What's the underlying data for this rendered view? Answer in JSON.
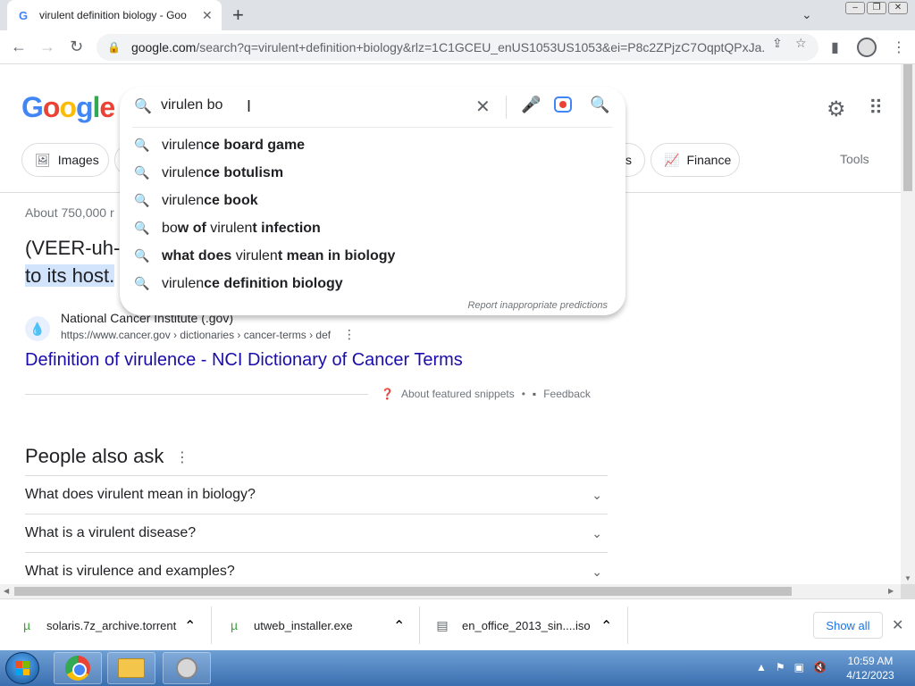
{
  "browser": {
    "tab_title": "virulent definition biology - Goo",
    "tab_favicon": "G",
    "url_main": "google.com",
    "url_rest": "/search?q=virulent+definition+biology&rlz=1C1GCEU_enUS1053US1053&ei=P8c2ZPjzC7OqptQPxJa..."
  },
  "google": {
    "logo_letters": [
      "G",
      "o",
      "o",
      "g",
      "l",
      "e"
    ],
    "logo_colors": [
      "#4285f4",
      "#ea4335",
      "#fbbc05",
      "#4285f4",
      "#34a853",
      "#ea4335"
    ]
  },
  "search": {
    "query": "virulen bo",
    "suggestions": [
      {
        "plain": "virulen",
        "bold": "ce bo",
        "rest": "ard game"
      },
      {
        "plain": "virulen",
        "bold": "ce bo",
        "rest": "tulism"
      },
      {
        "plain": "virulen",
        "bold": "ce bo",
        "rest": "ok"
      },
      {
        "plain": "bo",
        "bold": "w of ",
        "rest": "virulent infection"
      },
      {
        "plain": "what does ",
        "bold": "",
        "rest": "virulent mean in biology"
      },
      {
        "plain": "virulen",
        "bold": "ce",
        "rest": " definition biology"
      }
    ],
    "report_label": "Report inappropriate predictions"
  },
  "chips": {
    "images": "Images",
    "partial": "s",
    "finance": "Finance",
    "tools": "Tools"
  },
  "results": {
    "count": "About 750,000 r",
    "snippet_line1": "(VEER-uh-l",
    "snippet_line2": "to its host.",
    "site_name": "National Cancer Institute (.gov)",
    "site_url": "https://www.cancer.gov › dictionaries › cancer-terms › def",
    "link_title": "Definition of virulence - NCI Dictionary of Cancer Terms",
    "about_snippets": "About featured snippets",
    "dot": "•",
    "feedback": "Feedback"
  },
  "people_also_ask": {
    "title": "People also ask",
    "questions": [
      "What does virulent mean in biology?",
      "What is a virulent disease?",
      "What is virulence and examples?"
    ]
  },
  "downloads": {
    "items": [
      {
        "name": "solaris.7z_archive.torrent"
      },
      {
        "name": "utweb_installer.exe"
      },
      {
        "name": "en_office_2013_sin....iso"
      }
    ],
    "show_all": "Show all"
  },
  "taskbar": {
    "time": "10:59 AM",
    "date": "4/12/2023"
  }
}
